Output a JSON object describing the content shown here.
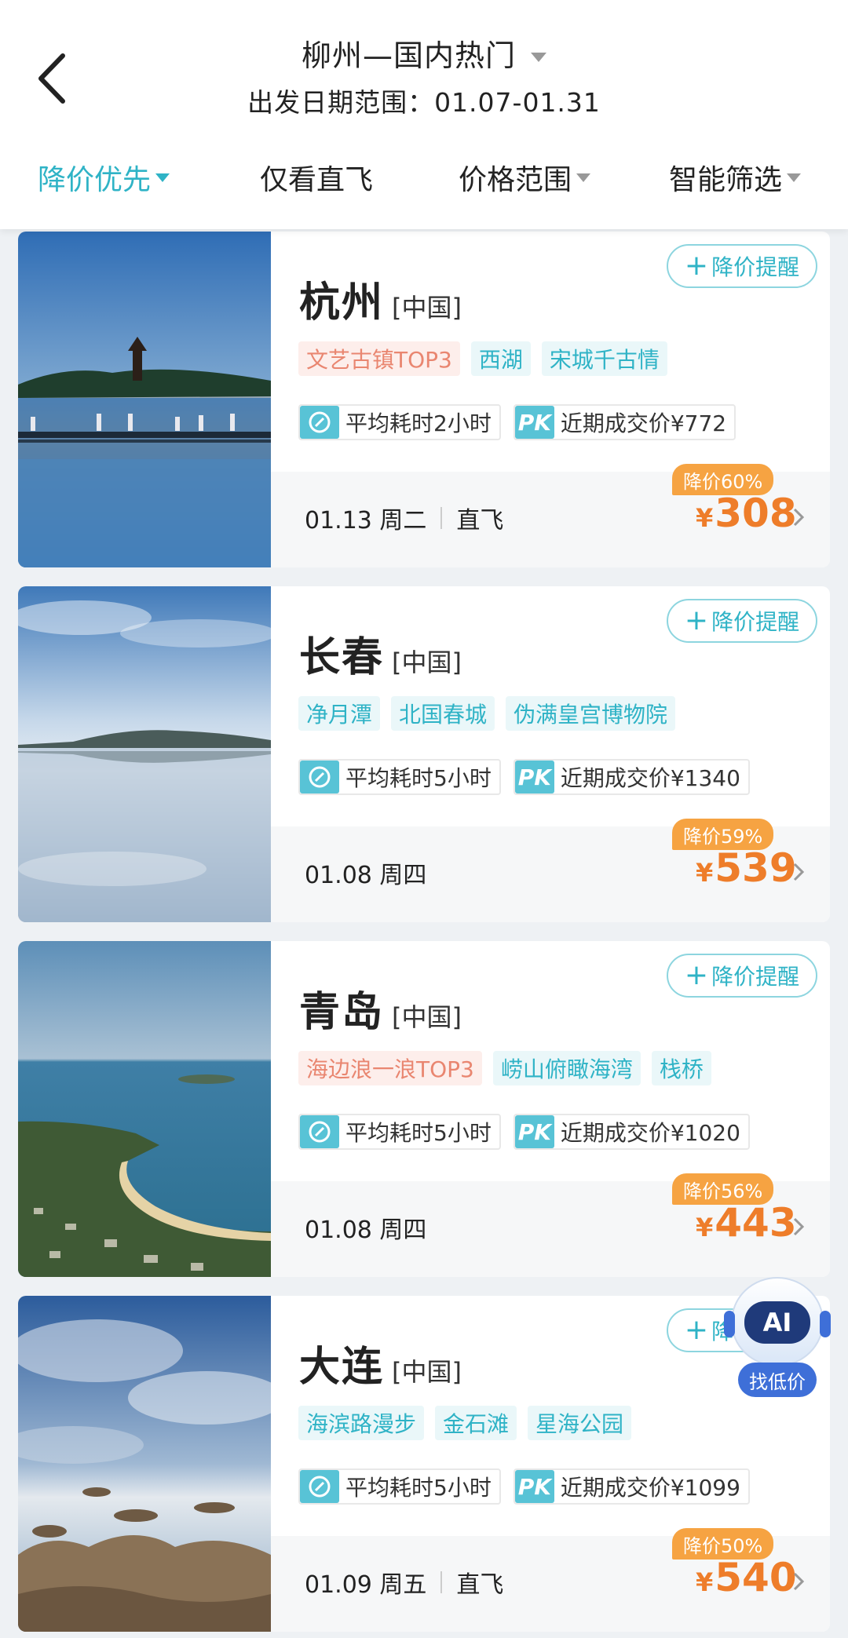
{
  "header": {
    "title": "柳州—国内热门",
    "subtitle": "出发日期范围：01.07-01.31",
    "filters": [
      {
        "label": "降价优先"
      },
      {
        "label": "仅看直飞"
      },
      {
        "label": "价格范围"
      },
      {
        "label": "智能筛选"
      }
    ]
  },
  "alert_label": "降价提醒",
  "ai": {
    "badge": "AI",
    "label": "找低价"
  },
  "cards": [
    {
      "city": "杭州",
      "country": "[中国]",
      "tags": [
        "文艺古镇TOP3",
        "西湖",
        "宋城千古情"
      ],
      "avg_time": "平均耗时2小时",
      "pk_badge": "PK",
      "recent_price": "近期成交价¥772",
      "date": "01.13 周二",
      "direct": "直飞",
      "discount": "降价60%",
      "currency": "¥",
      "price": "308"
    },
    {
      "city": "长春",
      "country": "[中国]",
      "tags": [
        "净月潭",
        "北国春城",
        "伪满皇宫博物院"
      ],
      "avg_time": "平均耗时5小时",
      "pk_badge": "PK",
      "recent_price": "近期成交价¥1340",
      "date": "01.08 周四",
      "direct": "",
      "discount": "降价59%",
      "currency": "¥",
      "price": "539"
    },
    {
      "city": "青岛",
      "country": "[中国]",
      "tags": [
        "海边浪一浪TOP3",
        "崂山俯瞰海湾",
        "栈桥"
      ],
      "avg_time": "平均耗时5小时",
      "pk_badge": "PK",
      "recent_price": "近期成交价¥1020",
      "date": "01.08 周四",
      "direct": "",
      "discount": "降价56%",
      "currency": "¥",
      "price": "443"
    },
    {
      "city": "大连",
      "country": "[中国]",
      "tags": [
        "海滨路漫步",
        "金石滩",
        "星海公园"
      ],
      "avg_time": "平均耗时5小时",
      "pk_badge": "PK",
      "recent_price": "近期成交价¥1099",
      "date": "01.09 周五",
      "direct": "直飞",
      "discount": "降价50%",
      "currency": "¥",
      "price": "540"
    }
  ]
}
